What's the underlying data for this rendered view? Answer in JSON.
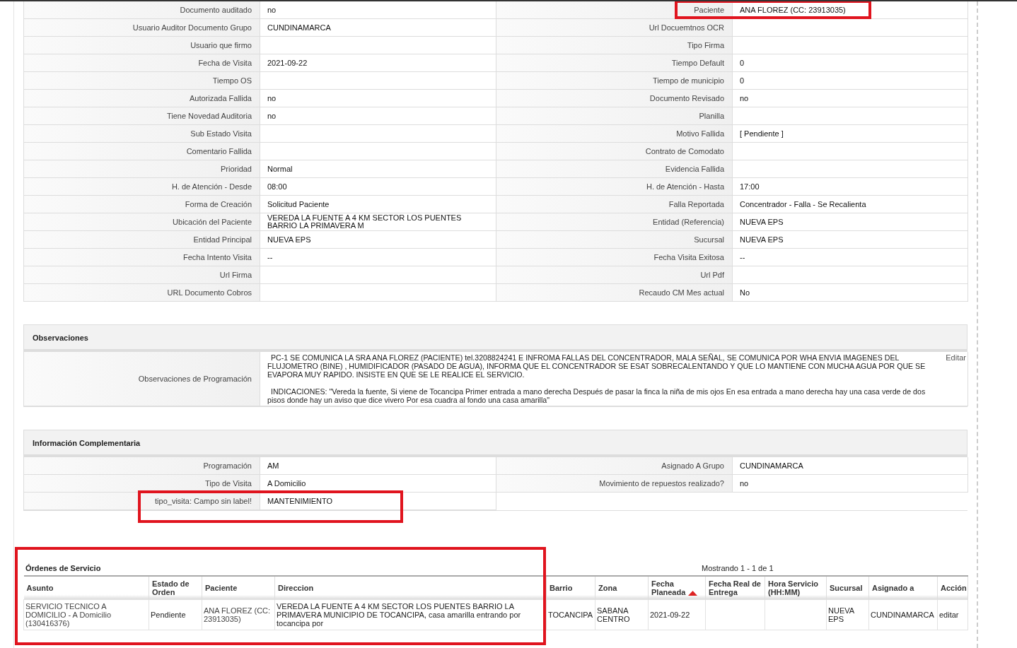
{
  "details": [
    {
      "left": {
        "label": "Documento auditado",
        "value": "no"
      },
      "right": {
        "label": "Paciente",
        "value": "ANA FLOREZ (CC: 23913035)",
        "highlighted": true
      }
    },
    {
      "left": {
        "label": "Usuario Auditor Documento Grupo",
        "value": "CUNDINAMARCA"
      },
      "right": {
        "label": "Url Docuemtnos OCR"
      }
    },
    {
      "left": {
        "label": "Usuario que firmo"
      },
      "right": {
        "label": "Tipo Firma"
      }
    },
    {
      "left": {
        "label": "Fecha de Visita",
        "value": "2021-09-22"
      },
      "right": {
        "label": "Tiempo Default",
        "value": "0"
      }
    },
    {
      "left": {
        "label": "Tiempo OS"
      },
      "right": {
        "label": "Tiempo de municipio",
        "value": "0"
      }
    },
    {
      "left": {
        "label": "Autorizada Fallida",
        "value": "no"
      },
      "right": {
        "label": "Documento Revisado",
        "value": "no"
      }
    },
    {
      "left": {
        "label": "Tiene Novedad Auditoria",
        "value": "no"
      },
      "right": {
        "label": "Planilla"
      }
    },
    {
      "left": {
        "label": "Sub Estado Visita"
      },
      "right": {
        "label": "Motivo Fallida",
        "value": "[ Pendiente ]"
      }
    },
    {
      "left": {
        "label": "Comentario Fallida"
      },
      "right": {
        "label": "Contrato de Comodato"
      }
    },
    {
      "left": {
        "label": "Prioridad",
        "value": "Normal"
      },
      "right": {
        "label": "Evidencia Fallida"
      }
    },
    {
      "left": {
        "label": "H. de Atención - Desde",
        "value": "08:00"
      },
      "right": {
        "label": "H. de Atención - Hasta",
        "value": "17:00"
      }
    },
    {
      "left": {
        "label": "Forma de Creación",
        "value": "Solicitud Paciente"
      },
      "right": {
        "label": "Falla Reportada",
        "value": "Concentrador - Falla - Se Recalienta"
      }
    },
    {
      "left": {
        "label": "Ubicación del Paciente",
        "value": "VEREDA LA FUENTE A 4 KM SECTOR LOS PUENTES BARRIO LA PRIMAVERA M"
      },
      "right": {
        "label": "Entidad (Referencia)",
        "value": "NUEVA EPS"
      }
    },
    {
      "left": {
        "label": "Entidad Principal",
        "value": "NUEVA EPS"
      },
      "right": {
        "label": "Sucursal",
        "value": "NUEVA EPS"
      }
    },
    {
      "left": {
        "label": "Fecha Intento Visita",
        "value": "--"
      },
      "right": {
        "label": "Fecha Visita Exitosa",
        "value": "--"
      }
    },
    {
      "left": {
        "label": "Url Firma"
      },
      "right": {
        "label": "Url Pdf"
      }
    },
    {
      "left": {
        "label": "URL Documento Cobros"
      },
      "right": {
        "label": "Recaudo CM Mes actual",
        "value": "No"
      }
    }
  ],
  "observaciones": {
    "title": "Observaciones",
    "label": "Observaciones de Programación",
    "paragraphs": [
      "PC-1 SE COMUNICA LA SRA ANA FLOREZ (PACIENTE) tel.3208824241 E INFROMA FALLAS DEL CONCENTRADOR, MALA SEÑAL, SE COMUNICA POR WHA ENVIA IMAGENES DEL FLUJOMETRO (BINE) , HUMIDIFICADOR (PASADO DE AGUA), INFORMA QUE EL CONCENTRADOR SE ESAT SOBRECALENTANDO Y QUE LO MANTIENE CON MUCHA AGUA POR QUE SE EVAPORA MUY RAPIDO. INSISTE EN QUE SE LE REALICE EL SERVICIO.",
      "INDICACIONES: \"Vereda la fuente, Si viene de Tocancipa Primer entrada a mano derecha Después de pasar la finca la niña de mis ojos En esa entrada a mano derecha hay una casa verde de dos pisos donde hay un aviso que dice vivero Por esa cuadra al fondo una casa amarilla\""
    ],
    "edit_link": "Editar"
  },
  "complementaria": {
    "title": "Información Complementaria",
    "rows": [
      {
        "left": {
          "label": "Programación",
          "value": "AM"
        },
        "right": {
          "label": "Asignado A Grupo",
          "value": "CUNDINAMARCA"
        }
      },
      {
        "left": {
          "label": "Tipo de Visita",
          "value": "A Domicilio"
        },
        "right": {
          "label": "Movimiento de repuestos realizado?",
          "value": "no"
        }
      },
      {
        "left": {
          "label": "tipo_visita: Campo sin label!",
          "value": "MANTENIMIENTO",
          "highlighted": true
        }
      }
    ]
  },
  "ordenes": {
    "title": "Órdenes de Servicio",
    "highlighted": true,
    "paging": "Mostrando 1 - 1 de 1",
    "columns": [
      {
        "label": "Asunto",
        "sorted": false
      },
      {
        "label": "Estado de Orden",
        "sorted": false
      },
      {
        "label": "Paciente",
        "sorted": false
      },
      {
        "label": "Direccion",
        "sorted": false
      },
      {
        "label": "Barrio",
        "sorted": false
      },
      {
        "label": "Zona",
        "sorted": false
      },
      {
        "label": "Fecha Planeada",
        "sorted": true
      },
      {
        "label": "Fecha Real de Entrega",
        "sorted": false
      },
      {
        "label": "Hora Servicio (HH:MM)",
        "sorted": false
      },
      {
        "label": "Sucursal",
        "sorted": false
      },
      {
        "label": "Asignado a",
        "sorted": false
      },
      {
        "label": "Acción",
        "sorted": false
      }
    ],
    "rows": [
      {
        "cells": [
          "SERVICIO TECNICO A DOMICILIO - A Domicilio (130416376)",
          "Pendiente",
          "ANA FLOREZ (CC: 23913035)",
          "VEREDA LA FUENTE A 4 KM SECTOR LOS PUENTES BARRIO LA PRIMAVERA MUNICIPIO DE TOCANCIPA, casa amarilla entrando por tocancipa por",
          "TOCANCIPA",
          "SABANA CENTRO",
          "2021-09-22",
          null,
          null,
          "NUEVA EPS",
          "CUNDINAMARCA",
          "editar"
        ]
      }
    ]
  }
}
